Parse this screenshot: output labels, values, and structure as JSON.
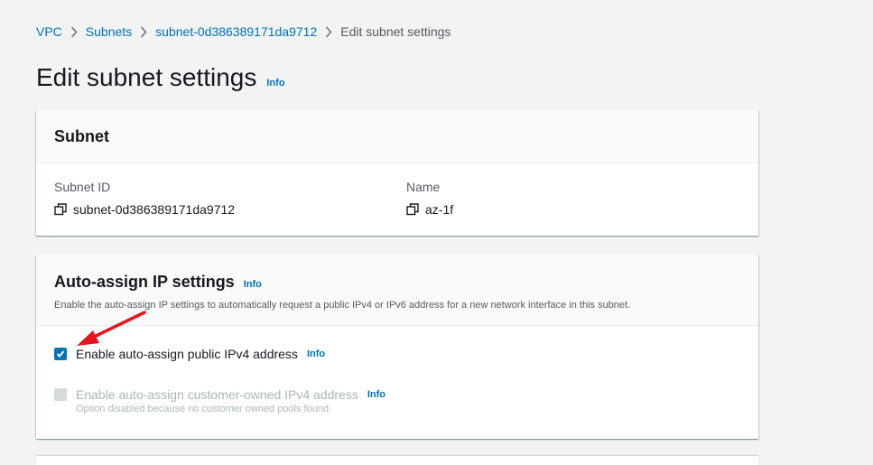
{
  "breadcrumb": {
    "items": [
      "VPC",
      "Subnets",
      "subnet-0d386389171da9712"
    ],
    "current": "Edit subnet settings"
  },
  "page": {
    "title": "Edit subnet settings",
    "info": "Info"
  },
  "subnet_panel": {
    "title": "Subnet",
    "subnet_id_label": "Subnet ID",
    "subnet_id_value": "subnet-0d386389171da9712",
    "name_label": "Name",
    "name_value": "az-1f"
  },
  "auto_assign_panel": {
    "title": "Auto-assign IP settings",
    "info": "Info",
    "description": "Enable the auto-assign IP settings to automatically request a public IPv4 or IPv6 address for a new network interface in this subnet.",
    "public_ipv4": {
      "label": "Enable auto-assign public IPv4 address",
      "info": "Info",
      "checked": true
    },
    "customer_owned_ipv4": {
      "label": "Enable auto-assign customer-owned IPv4 address",
      "info": "Info",
      "checked": false,
      "disabled": true,
      "hint": "Option disabled because no customer owned pools found."
    }
  },
  "colors": {
    "link": "#0073bb",
    "checkbox_checked": "#0073bb",
    "annotation_arrow": "#e8141b",
    "background": "#f2f3f3"
  }
}
